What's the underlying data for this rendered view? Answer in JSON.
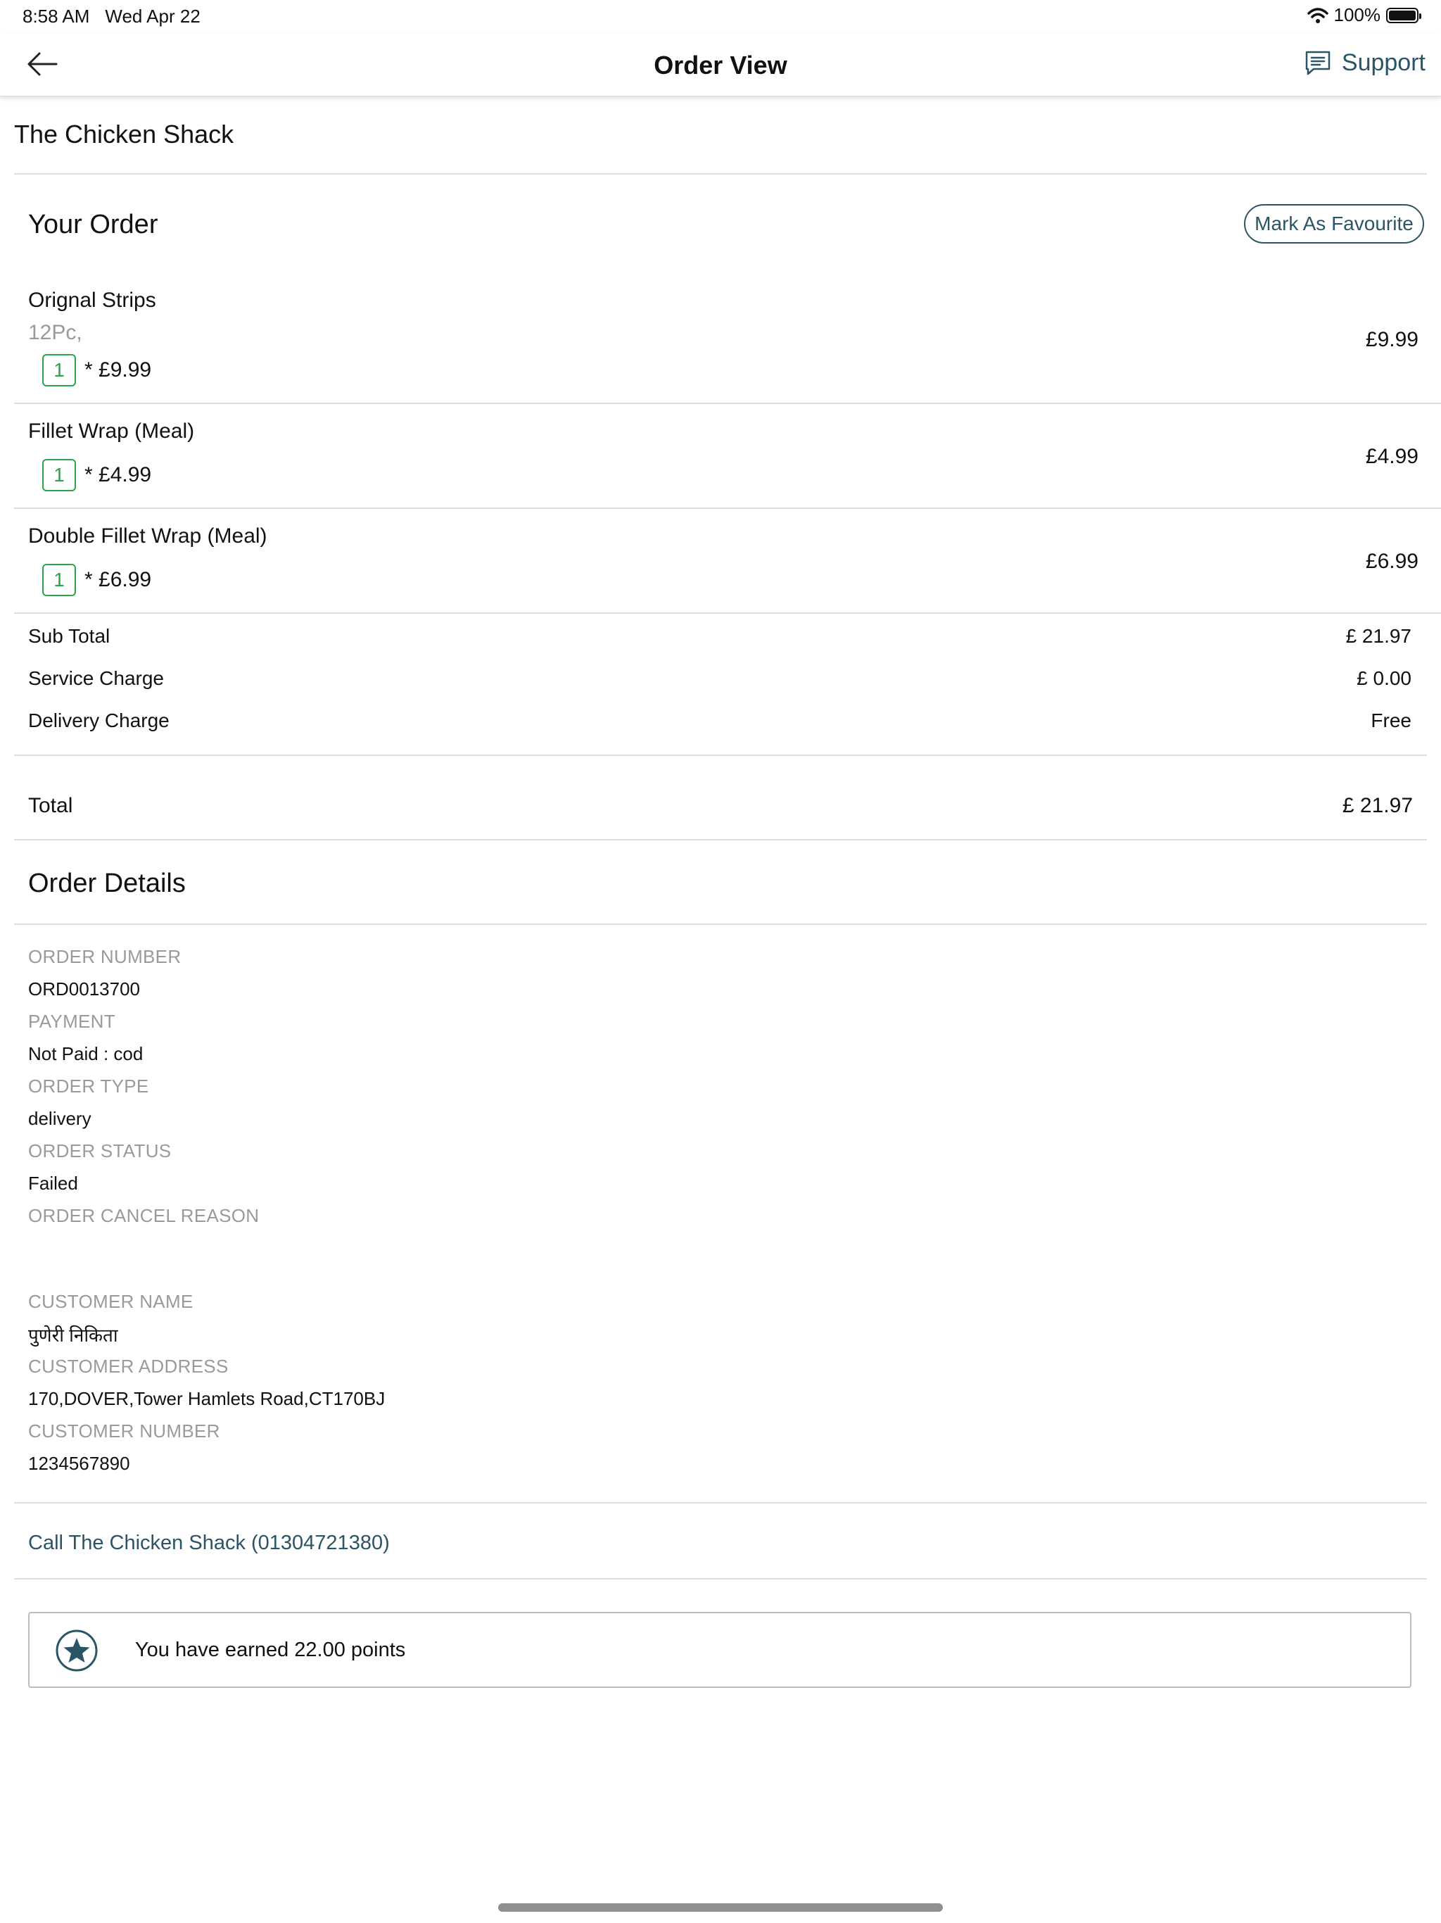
{
  "status_bar": {
    "time": "8:58 AM",
    "date": "Wed Apr 22",
    "battery": "100%"
  },
  "nav": {
    "title": "Order View",
    "support_label": "Support"
  },
  "restaurant": {
    "name": "The Chicken Shack"
  },
  "order": {
    "title": "Your Order",
    "favourite_label": "Mark As Favourite",
    "items": [
      {
        "name": "Orignal Strips",
        "option": "12Pc,",
        "qty": "1",
        "unit_price": "* £9.99",
        "total": "£9.99"
      },
      {
        "name": "Fillet Wrap (Meal)",
        "qty": "1",
        "unit_price": "* £4.99",
        "total": "£4.99"
      },
      {
        "name": "Double Fillet Wrap (Meal)",
        "qty": "1",
        "unit_price": "* £6.99",
        "total": "£6.99"
      }
    ],
    "summary": {
      "subtotal_label": "Sub Total",
      "subtotal": "£ 21.97",
      "service_label": "Service Charge",
      "service": "£ 0.00",
      "delivery_label": "Delivery Charge",
      "delivery": "Free"
    },
    "total_label": "Total",
    "total": "£ 21.97"
  },
  "details": {
    "title": "Order Details",
    "order_number_label": "ORDER NUMBER",
    "order_number": "ORD0013700",
    "payment_label": "PAYMENT",
    "payment": "Not Paid : cod",
    "order_type_label": "ORDER TYPE",
    "order_type": "delivery",
    "order_status_label": "ORDER STATUS",
    "order_status": "Failed",
    "cancel_reason_label": "ORDER CANCEL REASON",
    "customer_name_label": "CUSTOMER NAME",
    "customer_name": "पुणेरी निकिता",
    "customer_address_label": "CUSTOMER ADDRESS",
    "customer_address": "170,DOVER,Tower Hamlets Road,CT170BJ",
    "customer_number_label": "CUSTOMER NUMBER",
    "customer_number": "1234567890"
  },
  "call": {
    "label": "Call The Chicken Shack (01304721380)"
  },
  "points": {
    "text": "You have earned 22.00 points"
  },
  "colors": {
    "accent": "#2b5566",
    "qty_green": "#2aa54a",
    "muted": "#9a9a9a",
    "divider": "#dcdcdc"
  }
}
